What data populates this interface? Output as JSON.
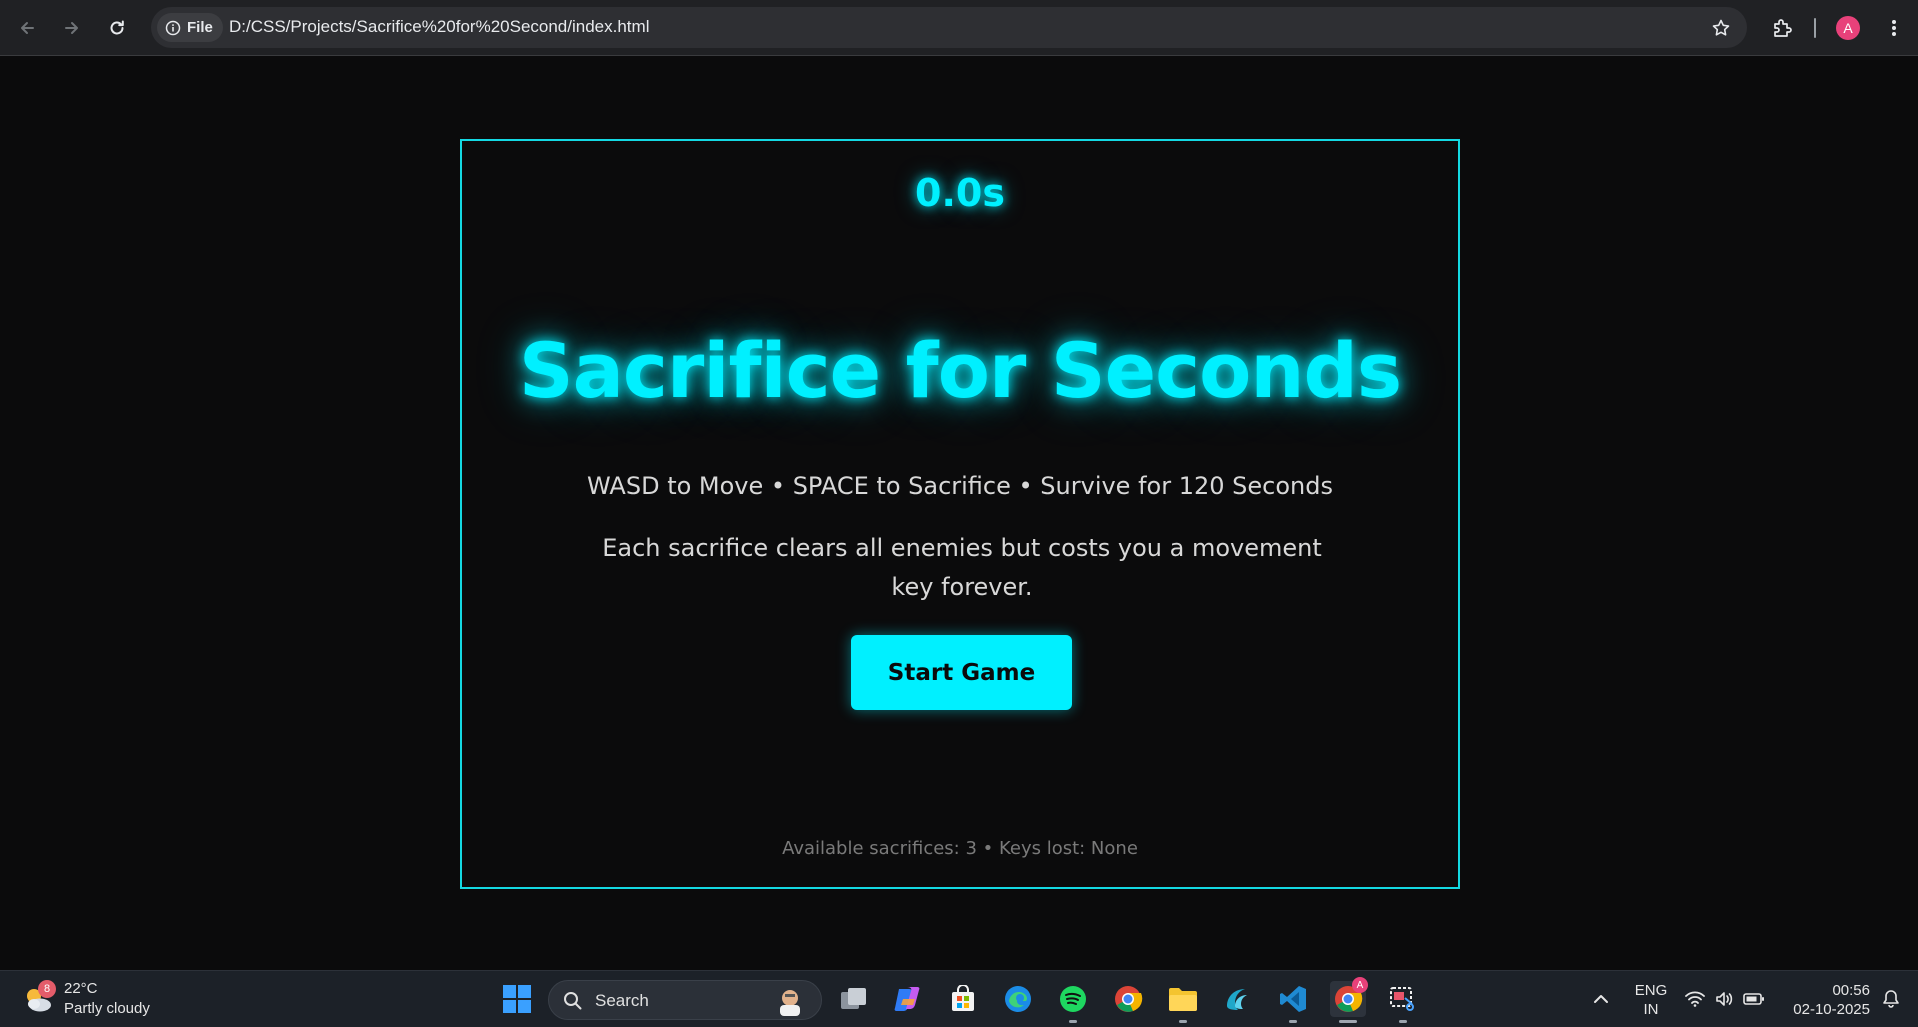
{
  "browser": {
    "chip_label": "File",
    "url": "D:/CSS/Projects/Sacrifice%20for%20Second/index.html",
    "profile_initial": "A"
  },
  "game": {
    "timer": "0.0s",
    "title": "Sacrifice for Seconds",
    "controls": "WASD to Move • SPACE to Sacrifice • Survive for 120 Seconds",
    "description": "Each sacrifice clears all enemies but costs you a movement key forever.",
    "start_label": "Start Game",
    "status": "Available sacrifices: 3 • Keys lost: None",
    "accent_color": "#00f0ff"
  },
  "taskbar": {
    "weather_temp": "22°C",
    "weather_desc": "Partly cloudy",
    "weather_badge": "8",
    "search_label": "Search",
    "chrome_badge": "A",
    "lang_line1": "ENG",
    "lang_line2": "IN",
    "time": "00:56",
    "date": "02-10-2025"
  }
}
